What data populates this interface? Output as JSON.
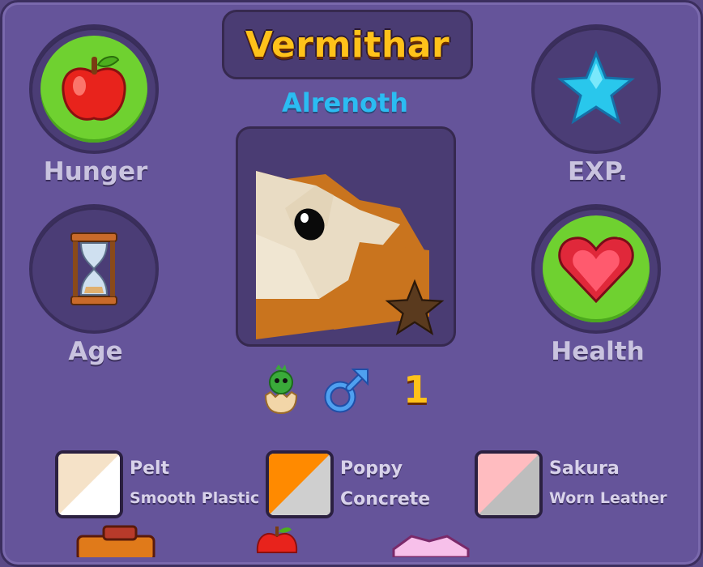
{
  "pet": {
    "name": "Vermithar",
    "species": "Alrenoth",
    "level": "1",
    "gender_icon": "male-symbol-icon",
    "stage_icon": "hatchling-egg-icon"
  },
  "stats": {
    "hunger": {
      "label": "Hunger",
      "icon": "apple-icon"
    },
    "age": {
      "label": "Age",
      "icon": "hourglass-icon"
    },
    "exp": {
      "label": "EXP.",
      "icon": "star-icon"
    },
    "health": {
      "label": "Health",
      "icon": "heart-icon"
    }
  },
  "colors": {
    "title": "#ffc21a",
    "species": "#2bbcf2",
    "panel": "#65549a",
    "stat_fill": "#6fd130"
  },
  "swatches": [
    {
      "name": "Pelt",
      "material": "Smooth Plastic",
      "color_a": "#f5e2c8",
      "color_b": "#ffffff"
    },
    {
      "name": "Poppy",
      "material": "Concrete",
      "color_a": "#ff8a00",
      "color_b": "#cfcfcf"
    },
    {
      "name": "Sakura",
      "material": "Worn Leather",
      "color_a": "#ffbcc0",
      "color_b": "#bdbdbd"
    }
  ]
}
